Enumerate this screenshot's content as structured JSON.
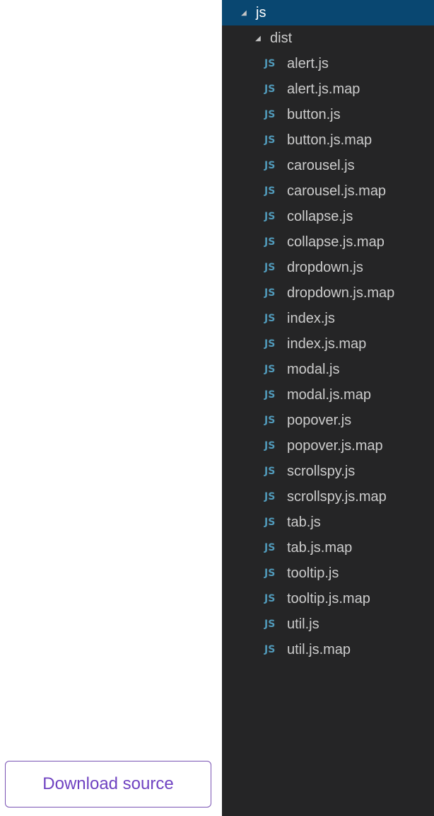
{
  "explorer": {
    "root": {
      "label": "js",
      "expanded_icon": "triangle-down-icon"
    },
    "folder": {
      "label": "dist",
      "expanded_icon": "triangle-down-icon"
    },
    "file_icon_text": "JS",
    "files": [
      "alert.js",
      "alert.js.map",
      "button.js",
      "button.js.map",
      "carousel.js",
      "carousel.js.map",
      "collapse.js",
      "collapse.js.map",
      "dropdown.js",
      "dropdown.js.map",
      "index.js",
      "index.js.map",
      "modal.js",
      "modal.js.map",
      "popover.js",
      "popover.js.map",
      "scrollspy.js",
      "scrollspy.js.map",
      "tab.js",
      "tab.js.map",
      "tooltip.js",
      "tooltip.js.map",
      "util.js",
      "util.js.map"
    ]
  },
  "download_button": {
    "label": "Download source"
  },
  "colors": {
    "sidebar_bg": "#252526",
    "selected_bg": "#094771",
    "js_icon": "#519aba",
    "button_border": "#7952b3",
    "button_text": "#6f42c1"
  }
}
